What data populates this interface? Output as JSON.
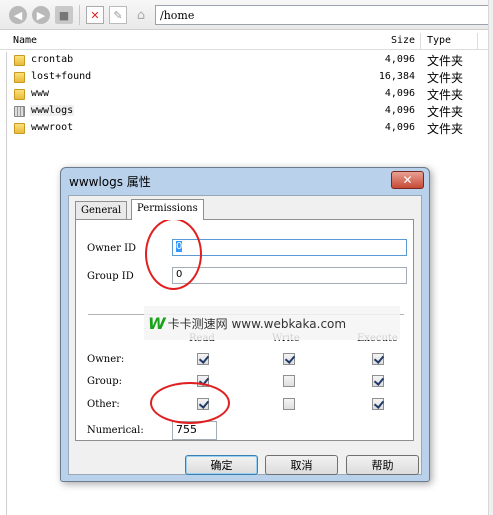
{
  "toolbar": {
    "path": "/home",
    "icons": [
      "back-icon",
      "forward-icon",
      "folder-up-icon",
      "delete-icon",
      "rename-icon",
      "home-icon"
    ]
  },
  "file_list": {
    "columns": {
      "name": "Name",
      "size": "Size",
      "type": "Type"
    },
    "rows": [
      {
        "name": "crontab",
        "size": "4,096",
        "type": "文件夹"
      },
      {
        "name": "lost+found",
        "size": "16,384",
        "type": "文件夹"
      },
      {
        "name": "www",
        "size": "4,096",
        "type": "文件夹"
      },
      {
        "name": "wwwlogs",
        "size": "4,096",
        "type": "文件夹"
      },
      {
        "name": "wwwroot",
        "size": "4,096",
        "type": "文件夹"
      }
    ]
  },
  "dialog": {
    "title": "wwwlogs 属性",
    "close_label": "✕",
    "tabs": [
      "General",
      "Permissions"
    ],
    "owner_id_label": "Owner ID",
    "owner_id_value": "0",
    "group_id_label": "Group ID",
    "group_id_value": "0",
    "perm_headers": {
      "read": "Read",
      "write": "Write",
      "execute": "Execute"
    },
    "perm_rows": [
      {
        "label": "Owner:",
        "read": true,
        "write": true,
        "execute": true
      },
      {
        "label": "Group:",
        "read": true,
        "write": false,
        "execute": true
      },
      {
        "label": "Other:",
        "read": true,
        "write": false,
        "execute": true
      }
    ],
    "numerical_label": "Numerical:",
    "numerical_value": "755",
    "buttons": {
      "ok": "确定",
      "cancel": "取消",
      "help": "帮助"
    }
  },
  "watermark": {
    "logo": "W",
    "text": "卡卡测速网 www.webkaka.com"
  },
  "colors": {
    "annotation_red": "#e02020",
    "selection_blue": "#3399ff",
    "folder_yellow": "#f2c94c"
  }
}
